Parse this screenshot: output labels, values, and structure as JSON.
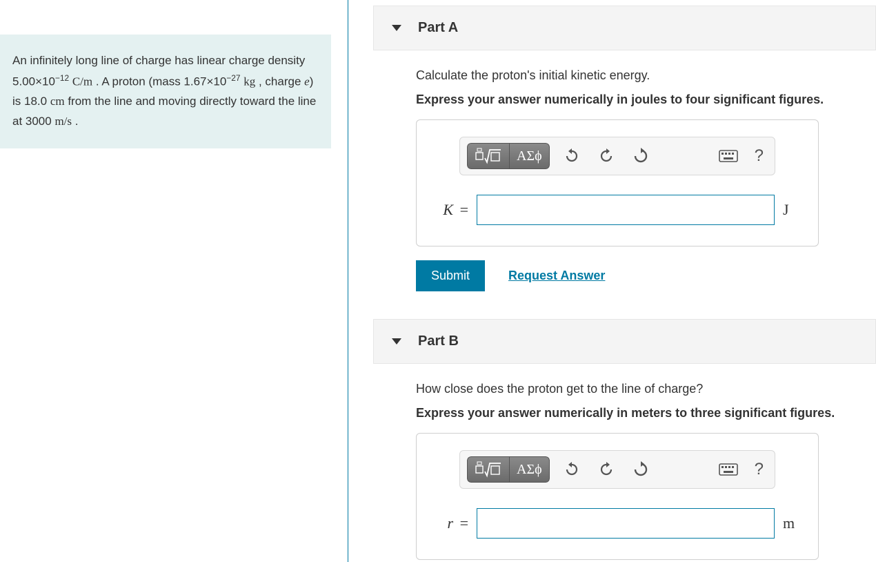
{
  "problem": {
    "text_html": "An infinitely long line of charge has linear charge density 5.00×10<sup>−12</sup> <span class='rm'>C/m</span> . A proton (mass 1.67×10<sup>−27</sup> <span class='rm'>kg</span> , charge <span class='rm it'>e</span>) is 18.0 <span class='rm'>cm</span> from the line and moving directly toward the line at 3000 <span class='rm'>m/s</span> ."
  },
  "parts": {
    "A": {
      "title": "Part A",
      "question": "Calculate the proton's initial kinetic energy.",
      "instruction": "Express your answer numerically in joules to four significant figures.",
      "lhs": "K",
      "unit": "J"
    },
    "B": {
      "title": "Part B",
      "question": "How close does the proton get to the line of charge?",
      "instruction": "Express your answer numerically in meters to three significant figures.",
      "lhs": "r",
      "unit": "m"
    }
  },
  "toolbar": {
    "greek_label": "ΑΣϕ",
    "help_label": "?"
  },
  "buttons": {
    "submit": "Submit",
    "request_answer": "Request Answer"
  }
}
